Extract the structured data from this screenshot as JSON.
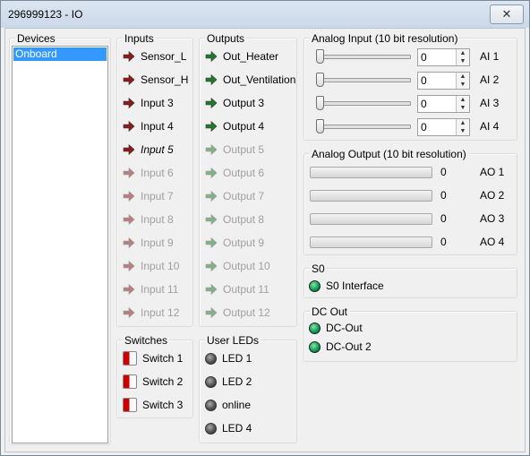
{
  "window": {
    "title": "296999123 - IO",
    "close_glyph": "✕"
  },
  "devices": {
    "label": "Devices",
    "items": [
      "Onboard"
    ]
  },
  "inputs": {
    "label": "Inputs",
    "items": [
      {
        "label": "Sensor_L",
        "state": "active"
      },
      {
        "label": "Sensor_H",
        "state": "active"
      },
      {
        "label": "Input 3",
        "state": "active"
      },
      {
        "label": "Input 4",
        "state": "active"
      },
      {
        "label": "Input 5",
        "state": "italic"
      },
      {
        "label": "Input 6",
        "state": "disabled"
      },
      {
        "label": "Input 7",
        "state": "disabled"
      },
      {
        "label": "Input 8",
        "state": "disabled"
      },
      {
        "label": "Input 9",
        "state": "disabled"
      },
      {
        "label": "Input 10",
        "state": "disabled"
      },
      {
        "label": "Input 11",
        "state": "disabled"
      },
      {
        "label": "Input 12",
        "state": "disabled"
      }
    ]
  },
  "outputs": {
    "label": "Outputs",
    "items": [
      {
        "label": "Out_Heater",
        "state": "active"
      },
      {
        "label": "Out_Ventilation",
        "state": "active"
      },
      {
        "label": "Output 3",
        "state": "active"
      },
      {
        "label": "Output 4",
        "state": "active"
      },
      {
        "label": "Output 5",
        "state": "disabled"
      },
      {
        "label": "Output 6",
        "state": "disabled"
      },
      {
        "label": "Output 7",
        "state": "disabled"
      },
      {
        "label": "Output 8",
        "state": "disabled"
      },
      {
        "label": "Output 9",
        "state": "disabled"
      },
      {
        "label": "Output 10",
        "state": "disabled"
      },
      {
        "label": "Output 11",
        "state": "disabled"
      },
      {
        "label": "Output 12",
        "state": "disabled"
      }
    ]
  },
  "switches": {
    "label": "Switches",
    "items": [
      "Switch 1",
      "Switch 2",
      "Switch 3"
    ]
  },
  "user_leds": {
    "label": "User LEDs",
    "items": [
      "LED 1",
      "LED 2",
      "online",
      "LED 4"
    ]
  },
  "analog_input": {
    "label": "Analog Input (10 bit resolution)",
    "items": [
      {
        "value": "0",
        "label": "AI 1"
      },
      {
        "value": "0",
        "label": "AI 2"
      },
      {
        "value": "0",
        "label": "AI 3"
      },
      {
        "value": "0",
        "label": "AI 4"
      }
    ]
  },
  "analog_output": {
    "label": "Analog Output (10 bit resolution)",
    "items": [
      {
        "value": "0",
        "label": "AO 1"
      },
      {
        "value": "0",
        "label": "AO 2"
      },
      {
        "value": "0",
        "label": "AO 3"
      },
      {
        "value": "0",
        "label": "AO 4"
      }
    ]
  },
  "s0": {
    "label": "S0",
    "items": [
      "S0 Interface"
    ]
  },
  "dc_out": {
    "label": "DC Out",
    "items": [
      "DC-Out",
      "DC-Out 2"
    ]
  },
  "colors": {
    "arrow_input": "#8b1a1a",
    "arrow_output": "#1f7a2a",
    "selection": "#3399ff"
  },
  "icons": {
    "input_arrow": "right-arrow-icon",
    "output_arrow": "right-arrow-icon",
    "led": "led-indicator-icon",
    "switch": "toggle-switch-icon"
  }
}
